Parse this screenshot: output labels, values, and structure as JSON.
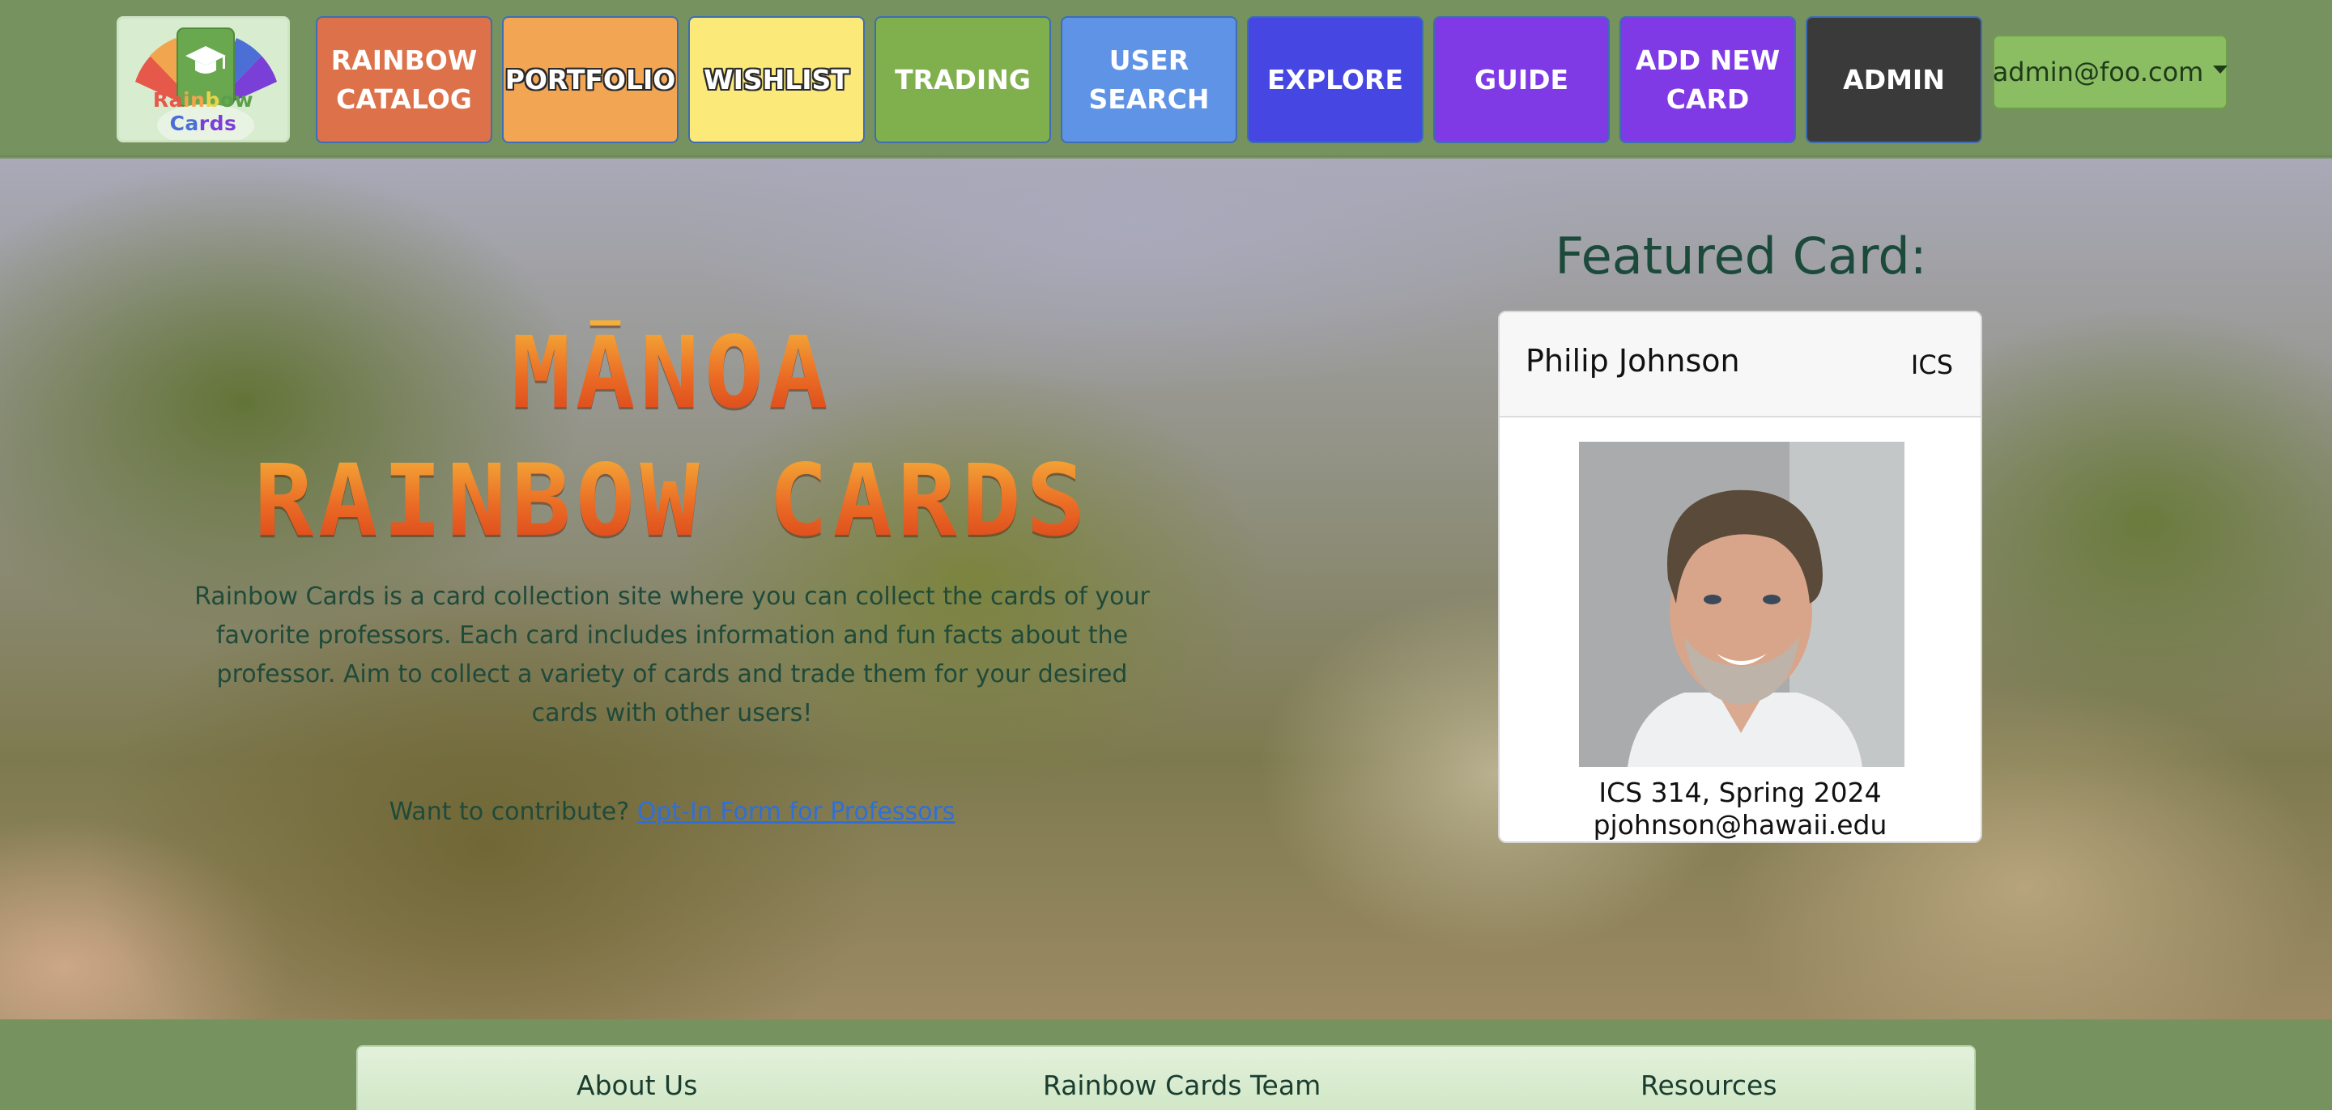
{
  "colors": {
    "navbar_bg": "#76935f",
    "catalog": "#dc714a",
    "portfolio": "#f2a653",
    "wishlist": "#fbe97a",
    "trading": "#80b04d",
    "user_search": "#5f93e5",
    "explore": "#4646e3",
    "guide": "#7f3ae6",
    "add_new_card": "#7f3ae6",
    "admin": "#3a3a3a",
    "link": "#2f6fd8"
  },
  "logo": {
    "icon": "graduation-cap-icon",
    "text_parts": [
      "Ra",
      "in",
      "b",
      "ow",
      " Ca",
      "rds"
    ]
  },
  "nav": {
    "catalog_label": "RAINBOW CATALOG",
    "portfolio_label": "PORTFOLIO",
    "wishlist_label": "WISHLIST",
    "trading_label": "TRADING",
    "user_search_label": "USER SEARCH",
    "explore_label": "EXPLORE",
    "guide_label": "GUIDE",
    "add_new_card_label": "ADD NEW CARD",
    "admin_label": "ADMIN",
    "user_email": "admin@foo.com"
  },
  "hero": {
    "title_line1": "MĀNOA",
    "title_line2": "RAINBOW CARDS",
    "description": "Rainbow Cards is a card collection site where you can collect the cards of your favorite professors. Each card includes information and fun facts about the professor. Aim to collect a variety of cards and trade them for your desired cards with other users!",
    "contribute_prefix": "Want to contribute? ",
    "contribute_link": "Opt-In Form for Professors"
  },
  "featured": {
    "heading": "Featured Card:",
    "name": "Philip Johnson",
    "department": "ICS",
    "course": "ICS 314, Spring 2024",
    "email": "pjohnson@hawaii.edu"
  },
  "footer": {
    "about": "About Us",
    "team": "Rainbow Cards Team",
    "resources": "Resources"
  }
}
